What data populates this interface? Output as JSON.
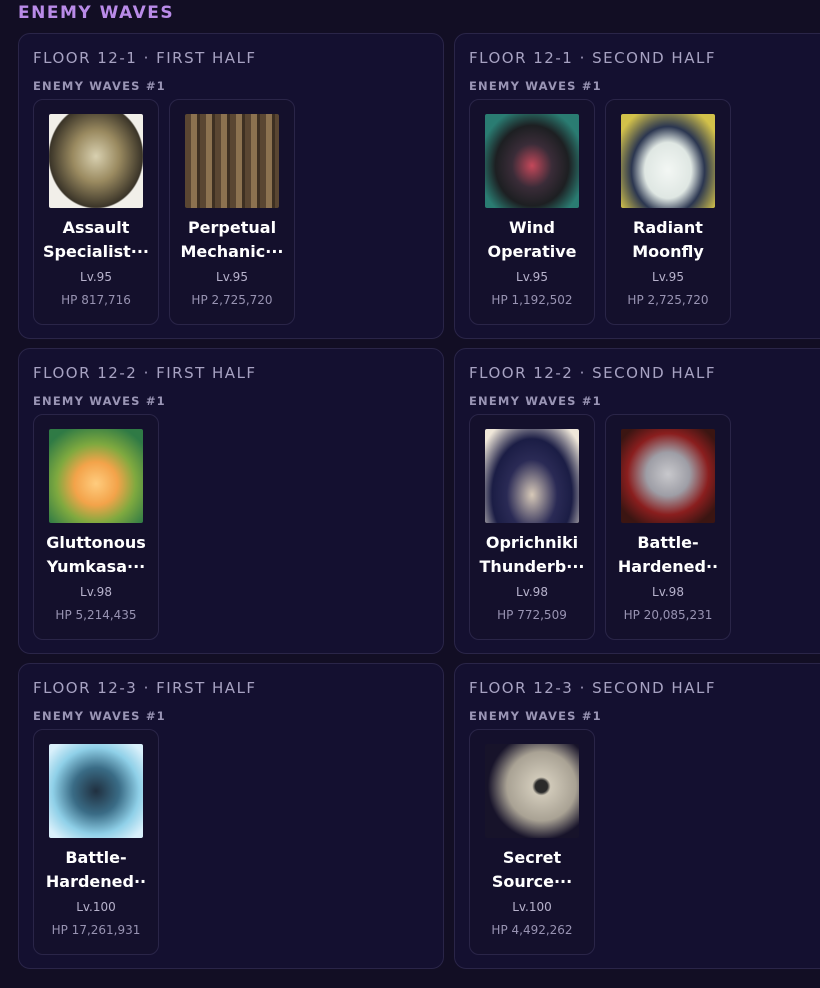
{
  "page": {
    "title": "ENEMY WAVES"
  },
  "panels": [
    {
      "title": "FLOOR 12-1 · FIRST HALF",
      "wave": "ENEMY WAVES #1",
      "enemies": [
        {
          "name1": "Assault",
          "name2": "Specialist···",
          "level": "Lv.95",
          "hp": "HP 817,716",
          "portrait": "assault-specialist-portrait"
        },
        {
          "name1": "Perpetual",
          "name2": "Mechanic···",
          "level": "Lv.95",
          "hp": "HP 2,725,720",
          "portrait": "perpetual-mechanical-array-portrait"
        }
      ]
    },
    {
      "title": "FLOOR 12-1 · SECOND HALF",
      "wave": "ENEMY WAVES #1",
      "enemies": [
        {
          "name1": "Wind",
          "name2": "Operative",
          "level": "Lv.95",
          "hp": "HP 1,192,502",
          "portrait": "wind-operative-portrait"
        },
        {
          "name1": "Radiant",
          "name2": "Moonfly",
          "level": "Lv.95",
          "hp": "HP 2,725,720",
          "portrait": "radiant-moonfly-portrait"
        }
      ]
    },
    {
      "title": "FLOOR 12-2 · FIRST HALF",
      "wave": "ENEMY WAVES #1",
      "enemies": [
        {
          "name1": "Gluttonous",
          "name2": "Yumkasa···",
          "level": "Lv.98",
          "hp": "HP 5,214,435",
          "portrait": "gluttonous-yumkasaur-portrait"
        }
      ]
    },
    {
      "title": "FLOOR 12-2 · SECOND HALF",
      "wave": "ENEMY WAVES #1",
      "enemies": [
        {
          "name1": "Oprichniki",
          "name2": "Thunderb···",
          "level": "Lv.98",
          "hp": "HP 772,509",
          "portrait": "oprichniki-thunderbolt-portrait"
        },
        {
          "name1": "Battle-",
          "name2": "Hardened··",
          "level": "Lv.98",
          "hp": "HP 20,085,231",
          "portrait": "battle-hardened-portrait"
        }
      ]
    },
    {
      "title": "FLOOR 12-3 · FIRST HALF",
      "wave": "ENEMY WAVES #1",
      "enemies": [
        {
          "name1": "Battle-",
          "name2": "Hardened··",
          "level": "Lv.100",
          "hp": "HP 17,261,931",
          "portrait": "battle-hardened-dragon-portrait"
        }
      ]
    },
    {
      "title": "FLOOR 12-3 · SECOND HALF",
      "wave": "ENEMY WAVES #1",
      "enemies": [
        {
          "name1": "Secret",
          "name2": "Source···",
          "level": "Lv.100",
          "hp": "HP 4,492,262",
          "portrait": "secret-source-automaton-portrait"
        }
      ]
    }
  ]
}
